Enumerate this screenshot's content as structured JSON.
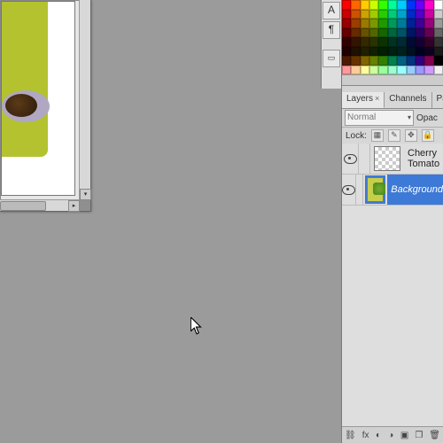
{
  "panels": {
    "tabs": [
      {
        "label": "Layers",
        "active": true,
        "closable": true
      },
      {
        "label": "Channels",
        "active": false,
        "closable": false
      },
      {
        "label": "Pat",
        "active": false,
        "closable": false
      }
    ],
    "blend_mode": "Normal",
    "opacity_label": "Opac",
    "lock_label": "Lock:"
  },
  "layers": [
    {
      "name": "Cherry Tomato",
      "visible": true,
      "selected": false,
      "thumb": "checker"
    },
    {
      "name": "Background",
      "visible": true,
      "selected": true,
      "thumb": "bg"
    }
  ],
  "mini_tools": {
    "type": "A",
    "paragraph": "¶"
  },
  "swatches": [
    "#ff0000",
    "#ff6600",
    "#ffcc00",
    "#ccff00",
    "#33ff00",
    "#00ff99",
    "#00ccff",
    "#0033ff",
    "#6600ff",
    "#ff00cc",
    "#ffffff",
    "#cc0000",
    "#cc5200",
    "#cca300",
    "#a3cc00",
    "#29cc00",
    "#00cc7a",
    "#00a3cc",
    "#0029cc",
    "#5200cc",
    "#cc00a3",
    "#cccccc",
    "#990000",
    "#993d00",
    "#997a00",
    "#7a9900",
    "#1f9900",
    "#00995c",
    "#007a99",
    "#001f99",
    "#3d0099",
    "#99007a",
    "#999999",
    "#660000",
    "#662900",
    "#665200",
    "#526600",
    "#146600",
    "#00663d",
    "#005266",
    "#001466",
    "#290066",
    "#660052",
    "#666666",
    "#330000",
    "#331400",
    "#332900",
    "#293300",
    "#0a3300",
    "#00331f",
    "#002933",
    "#000a33",
    "#140033",
    "#330029",
    "#333333",
    "#200000",
    "#201000",
    "#202000",
    "#102000",
    "#002000",
    "#002010",
    "#002020",
    "#001020",
    "#000020",
    "#100020",
    "#1a1a1a",
    "#4d1a00",
    "#663300",
    "#806600",
    "#668000",
    "#338000",
    "#00804d",
    "#006080",
    "#003380",
    "#33007f",
    "#80004d",
    "#000000",
    "#ff9999",
    "#ffcc99",
    "#ffff99",
    "#ccff99",
    "#99ff99",
    "#99ffcc",
    "#99ffff",
    "#99ccff",
    "#9999ff",
    "#cc99ff",
    "#f0f0f0"
  ],
  "bottom_icons": [
    "link-icon",
    "fx-icon",
    "mask-icon",
    "adjustment-icon",
    "group-icon",
    "new-layer-icon",
    "trash-icon"
  ]
}
